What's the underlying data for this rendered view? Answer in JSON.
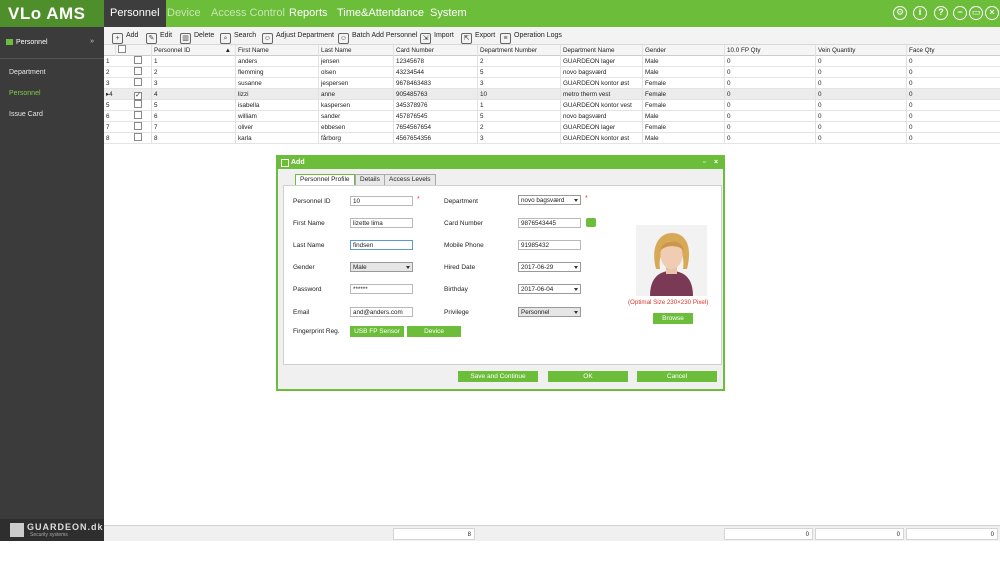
{
  "app": {
    "logo": "VLo AMS"
  },
  "menu": {
    "personnel": "Personnel",
    "device": "Device",
    "access_control": "Access Control",
    "reports": "Reports",
    "time_attendance": "Time&Attendance",
    "system": "System"
  },
  "sidebar": {
    "header": "Personnel",
    "items": [
      "Department",
      "Personnel",
      "Issue Card"
    ],
    "footer_name": "GUARDEON.dk",
    "footer_sub": "Security systems"
  },
  "toolbar": {
    "add": "Add",
    "edit": "Edit",
    "delete": "Delete",
    "search": "Search",
    "adjust_department": "Adjust Department",
    "batch_add": "Batch Add Personnel",
    "import": "Import",
    "export": "Export",
    "operation_logs": "Operation Logs"
  },
  "table": {
    "columns": [
      "Personnel ID",
      "First Name",
      "Last Name",
      "Card Number",
      "Department Number",
      "Department Name",
      "Gender",
      "10.0 FP Qty",
      "Vein Quantity",
      "Face Qty"
    ],
    "rows": [
      [
        "1",
        "anders",
        "jensen",
        "12345678",
        "2",
        "GUARDEON lager",
        "Male",
        "0",
        "0",
        "0"
      ],
      [
        "2",
        "flemming",
        "olsen",
        "43234544",
        "5",
        "novo bagsværd",
        "Male",
        "0",
        "0",
        "0"
      ],
      [
        "3",
        "susanne",
        "jespersen",
        "9678463483",
        "3",
        "GUARDEON kontor øst",
        "Female",
        "0",
        "0",
        "0"
      ],
      [
        "4",
        "lizzi",
        "anne",
        "905485763",
        "10",
        "metro therm vest",
        "Female",
        "0",
        "0",
        "0"
      ],
      [
        "5",
        "isabella",
        "kaspersen",
        "345378976",
        "1",
        "GUARDEON kontor vest",
        "Female",
        "0",
        "0",
        "0"
      ],
      [
        "6",
        "william",
        "sander",
        "457876545",
        "5",
        "novo bagsværd",
        "Male",
        "0",
        "0",
        "0"
      ],
      [
        "7",
        "oliver",
        "ebbesen",
        "7654567654",
        "2",
        "GUARDEON lager",
        "Female",
        "0",
        "0",
        "0"
      ],
      [
        "8",
        "karla",
        "fårborg",
        "4567654356",
        "3",
        "GUARDEON kontor øst",
        "Male",
        "0",
        "0",
        "0"
      ]
    ],
    "selected_row_marker": "▸4"
  },
  "status": {
    "count": "8",
    "fp_total": "0",
    "vein_total": "0",
    "face_total": "0"
  },
  "dialog": {
    "title": "Add",
    "tabs": [
      "Personnel Profile",
      "Details",
      "Access Levels"
    ],
    "labels": {
      "personnel_id": "Personnel ID",
      "first_name": "First Name",
      "last_name": "Last Name",
      "gender": "Gender",
      "password": "Password",
      "email": "Email",
      "fingerprint": "Fingerprint Reg.",
      "department": "Department",
      "card_number": "Card Number",
      "mobile_phone": "Mobile Phone",
      "hired_date": "Hired Date",
      "birthday": "Birthday",
      "privilege": "Privilege"
    },
    "values": {
      "personnel_id": "10",
      "first_name": "lizette lima",
      "last_name": "findsen",
      "gender": "Male",
      "password": "******",
      "email": "and@anders.com",
      "department": "novo bagsværd",
      "card_number": "9876543445",
      "mobile_phone": "91985432",
      "hired_date": "2017-06-29",
      "birthday": "2017-06-04",
      "privilege": "Personnel"
    },
    "required_mark": "*",
    "usb_fp_sensor": "USB FP Sensor",
    "device": "Device",
    "photo_hint": "(Optimal Size 230×230 Pixel)",
    "browse": "Browse",
    "save_continue": "Save and Continue",
    "ok": "OK",
    "cancel": "Cancel"
  },
  "colors": {
    "brand_green": "#6cbd3a",
    "dark_sidebar": "#3b3b3b",
    "hint_red": "#d9352c"
  }
}
